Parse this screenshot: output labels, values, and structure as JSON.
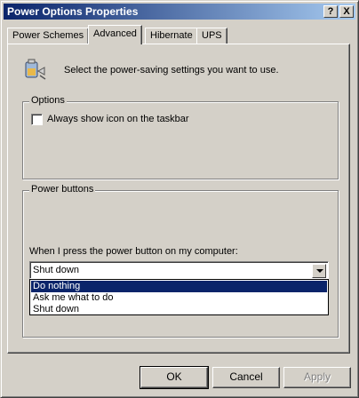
{
  "window": {
    "title": "Power Options Properties",
    "help_label": "?",
    "close_label": "X"
  },
  "tabs": [
    {
      "label": "Power Schemes"
    },
    {
      "label": "Advanced"
    },
    {
      "label": "Hibernate"
    },
    {
      "label": "UPS"
    }
  ],
  "intro_text": "Select the power-saving settings you want to use.",
  "options_group": {
    "label": "Options",
    "checkbox_label": "Always show icon on the taskbar",
    "checked": false
  },
  "power_buttons_group": {
    "label": "Power buttons",
    "prompt": "When I press the power button on my computer:",
    "selected_value": "Shut down",
    "options": [
      "Do nothing",
      "Ask me what to do",
      "Shut down"
    ],
    "highlighted_option": "Do nothing"
  },
  "buttons": {
    "ok": "OK",
    "cancel": "Cancel",
    "apply": "Apply"
  },
  "colors": {
    "title_start": "#0a246a",
    "title_end": "#a6caf0",
    "highlight": "#0a246a",
    "face": "#d4d0c8"
  }
}
